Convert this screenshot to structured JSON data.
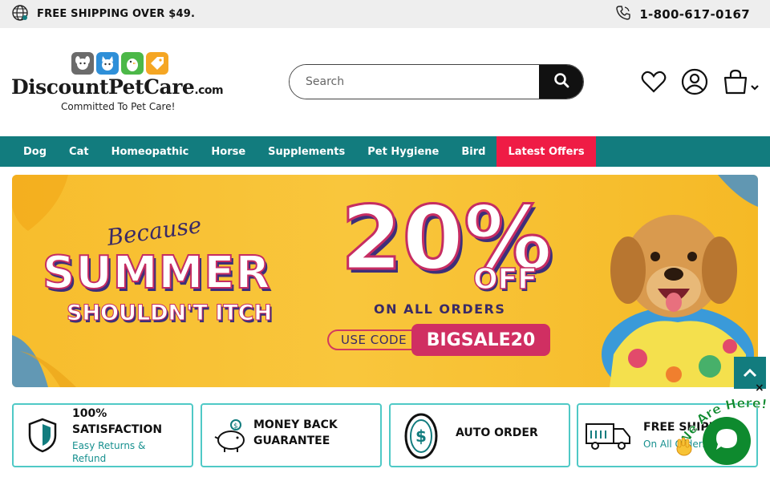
{
  "topbar": {
    "shipping_text": "FREE SHIPPING OVER $49.",
    "phone": "1-800-617-0167",
    "globe_icon": "globe-icon",
    "phone_icon": "phone-icon"
  },
  "header": {
    "logo_brand": "DiscountPetCare",
    "logo_suffix": ".com",
    "logo_tagline": "Committed To Pet Care!",
    "search_placeholder": "Search",
    "icons": [
      "search-icon",
      "heart-icon",
      "user-icon",
      "cart-icon",
      "chevron-down-icon"
    ]
  },
  "nav": {
    "items": [
      "Dog",
      "Cat",
      "Homeopathic",
      "Horse",
      "Supplements",
      "Pet Hygiene",
      "Bird",
      "Latest Offers"
    ]
  },
  "banner": {
    "because": "Because",
    "summer": "SUMMER",
    "itch": "SHOULDN'T ITCH",
    "percent": "20%",
    "off": "OFF",
    "on_all": "ON ALL ORDERS",
    "use_code": "USE CODE",
    "code": "BIGSALE20"
  },
  "features": [
    {
      "title": "100% SATISFACTION",
      "subtitle": "Easy Returns & Refund",
      "icon": "shield-icon"
    },
    {
      "title": "MONEY BACK GUARANTEE",
      "subtitle": "",
      "icon": "piggy-bank-icon"
    },
    {
      "title": "AUTO ORDER",
      "subtitle": "",
      "icon": "coin-icon"
    },
    {
      "title": "FREE SHIPPING",
      "subtitle": "On All Orders",
      "icon": "truck-icon"
    }
  ],
  "chat": {
    "label": "We Are Here!",
    "close": "×"
  },
  "colors": {
    "teal": "#127c7e",
    "offer_red": "#ef1c45",
    "feature_border": "#4fc9c6",
    "chat_green": "#0e8a2e",
    "banner_yellow": "#f7bd2d"
  }
}
